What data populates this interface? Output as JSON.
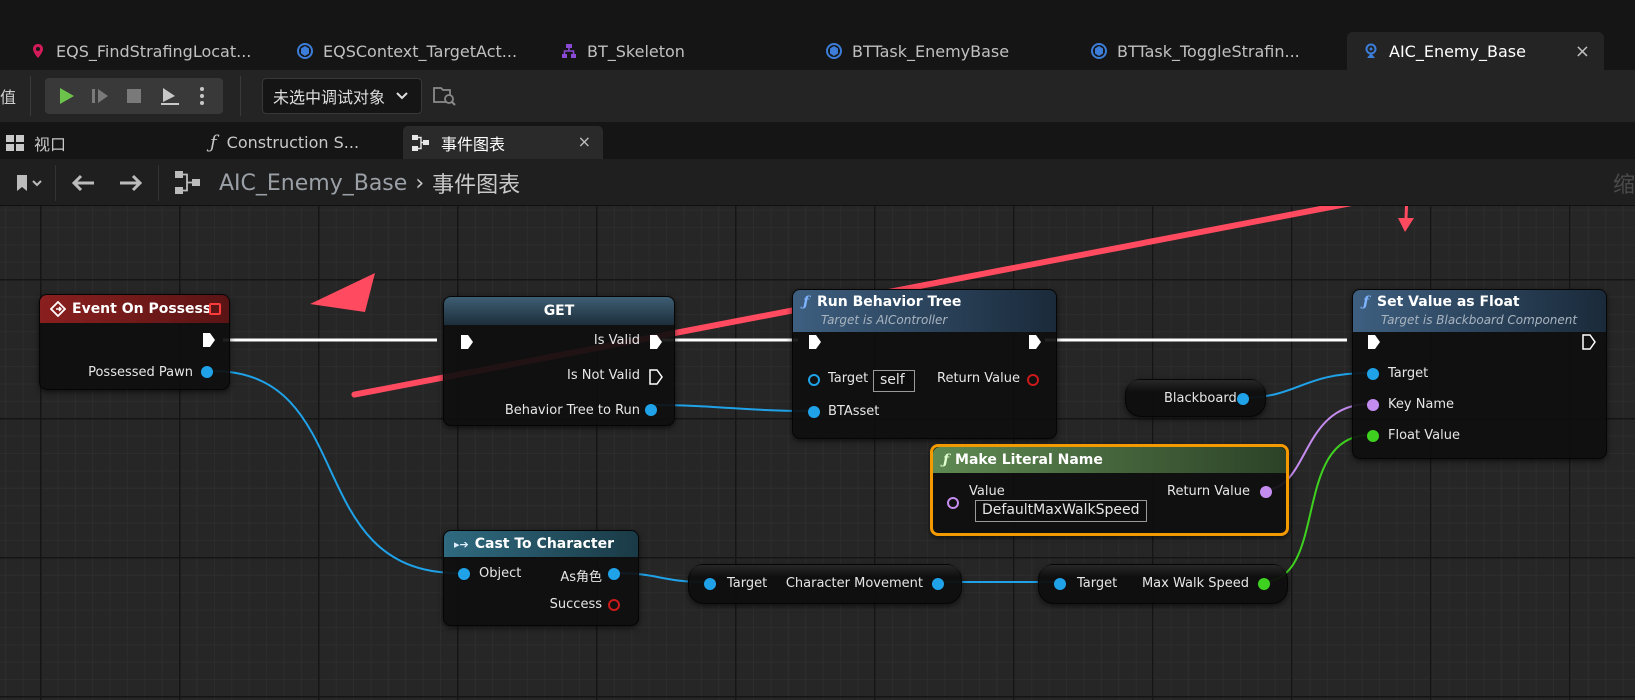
{
  "colors": {
    "accent_arrow": "#ff4a5f",
    "exec_wire": "#ffffff",
    "object_pin": "#1fa2e8",
    "name_pin": "#c58cf0",
    "float_pin": "#3fd11f",
    "bool_pin": "#cc1a1a",
    "event_header": "#7a1a1a",
    "function_header": "#3b5a78",
    "pure_header": "#4f7a47",
    "cast_header": "#2f5f72",
    "selected_outline": "#f29a00"
  },
  "tabs": [
    {
      "label": "EQS_FindStrafingLocat...",
      "icon": "eqs-query-icon",
      "icon_color": "#d21c5a"
    },
    {
      "label": "EQSContext_TargetAct...",
      "icon": "blueprint-class-icon",
      "icon_color": "#3b7dd8"
    },
    {
      "label": "BT_Skeleton",
      "icon": "behavior-tree-icon",
      "icon_color": "#8a4ad6"
    },
    {
      "label": "BTTask_EnemyBase",
      "icon": "blueprint-class-icon",
      "icon_color": "#3b7dd8"
    },
    {
      "label": "BTTask_ToggleStrafin...",
      "icon": "blueprint-class-icon",
      "icon_color": "#3b7dd8"
    },
    {
      "label": "AIC_Enemy_Base",
      "icon": "ai-controller-icon",
      "icon_color": "#3b7dd8",
      "active": true,
      "close": "×"
    }
  ],
  "toolbar": {
    "left_fragment": "值",
    "debug_filter": "未选中调试对象"
  },
  "panel_tabs": [
    {
      "label": "视口",
      "icon": "viewport-icon"
    },
    {
      "label": "Construction S...",
      "icon": "function-icon"
    },
    {
      "label": "事件图表",
      "icon": "event-graph-icon",
      "active": true,
      "close": "×"
    }
  ],
  "breadcrumb": {
    "root": "AIC_Enemy_Base",
    "separator": "›",
    "current": "事件图表"
  },
  "zoom_label": "缩",
  "nodes": {
    "event_on_possess": {
      "title": "Event On Possess",
      "pins": {
        "possessed_pawn": "Possessed Pawn"
      }
    },
    "get": {
      "title": "GET",
      "pins": {
        "is_valid": "Is Valid",
        "is_not_valid": "Is Not Valid",
        "bt_to_run": "Behavior Tree to Run"
      }
    },
    "run_behavior_tree": {
      "title": "Run Behavior Tree",
      "subtitle": "Target is AIController",
      "pins": {
        "target": "Target",
        "target_default": "self",
        "return_value": "Return Value",
        "bt_asset": "BTAsset"
      }
    },
    "set_value_as_float": {
      "title": "Set Value as Float",
      "subtitle": "Target is Blackboard Component",
      "pins": {
        "target": "Target",
        "key_name": "Key Name",
        "float_value": "Float Value"
      }
    },
    "blackboard": {
      "label": "Blackboard"
    },
    "make_literal_name": {
      "title": "Make Literal Name",
      "pins": {
        "value": "Value",
        "value_default": "DefaultMaxWalkSpeed",
        "return_value": "Return Value"
      }
    },
    "cast_to_character": {
      "title": "Cast To Character",
      "pins": {
        "object": "Object",
        "as_character": "As角色",
        "success": "Success"
      }
    },
    "character_movement": {
      "pins": {
        "target": "Target",
        "output": "Character Movement"
      }
    },
    "max_walk_speed": {
      "pins": {
        "target": "Target",
        "output": "Max Walk Speed"
      }
    }
  }
}
